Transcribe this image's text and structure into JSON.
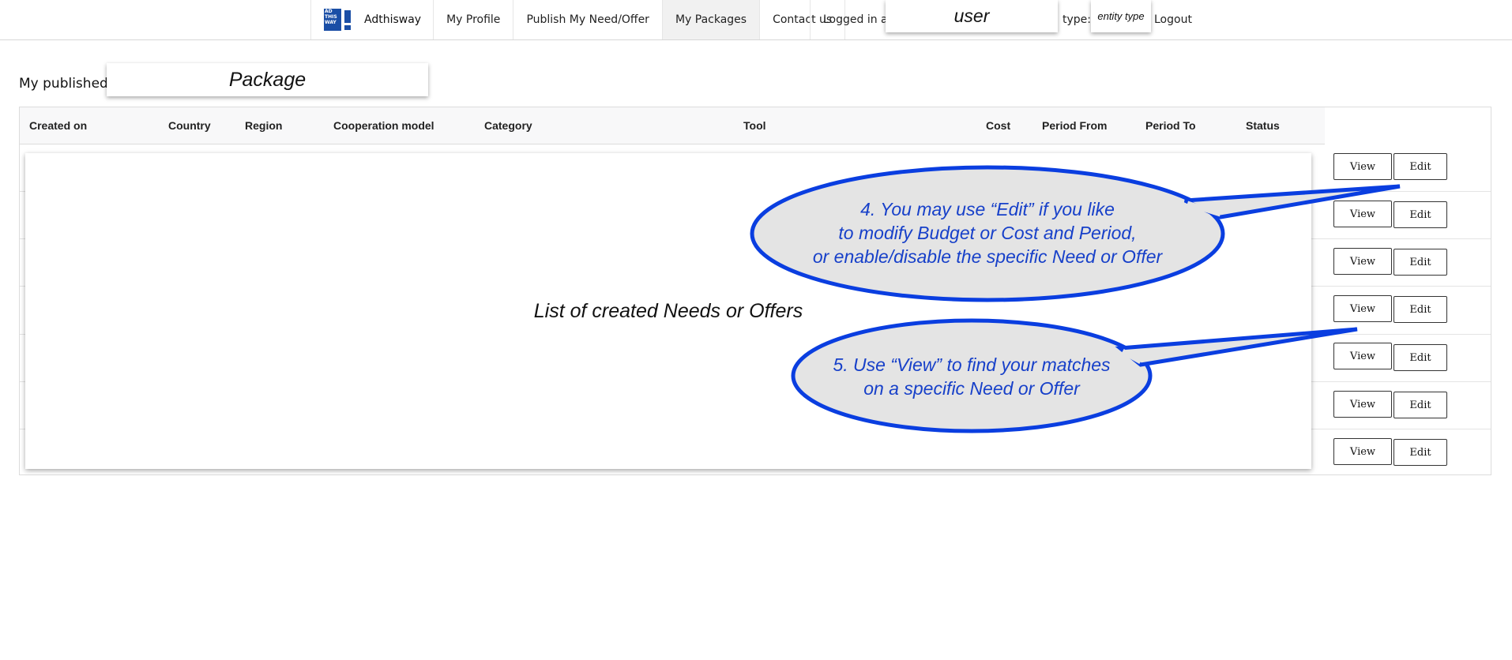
{
  "navbar": {
    "brand": "Adthisway",
    "logo_text": "AD THIS WAY",
    "items": [
      {
        "label": "My Profile"
      },
      {
        "label": "Publish My Need/Offer"
      },
      {
        "label": "My Packages",
        "active": true
      },
      {
        "label": "Contact us"
      }
    ],
    "logged_in_label": "Logged in as:",
    "user_value": "user",
    "type_label": "type:",
    "type_value": "entity type",
    "logout": "Logout"
  },
  "page": {
    "title": "My published",
    "title_overlay": "Package"
  },
  "table": {
    "columns": [
      "Created on",
      "Country",
      "Region",
      "Cooperation model",
      "Category",
      "Tool",
      "Cost",
      "Period From",
      "Period To",
      "Status"
    ],
    "placeholder": "List of created Needs or Offers",
    "rows": [
      {
        "view": "View",
        "edit": "Edit"
      },
      {
        "view": "View",
        "edit": "Edit"
      },
      {
        "view": "View",
        "edit": "Edit"
      },
      {
        "view": "View",
        "edit": "Edit"
      },
      {
        "view": "View",
        "edit": "Edit"
      },
      {
        "view": "View",
        "edit": "Edit"
      },
      {
        "view": "View",
        "edit": "Edit"
      }
    ]
  },
  "callouts": {
    "edit": {
      "line1": "4. You may use “Edit” if you like",
      "line2": "to modify Budget or Cost and Period,",
      "line3": "or enable/disable the specific Need or Offer"
    },
    "view": {
      "line1": "5. Use “View” to find your matches",
      "line2": "on a specific Need or Offer"
    }
  },
  "colors": {
    "brand_blue": "#1a4ea6",
    "callout_stroke": "#0a3ee0",
    "callout_fill": "#e4e4e4",
    "callout_text": "#1740c9"
  }
}
